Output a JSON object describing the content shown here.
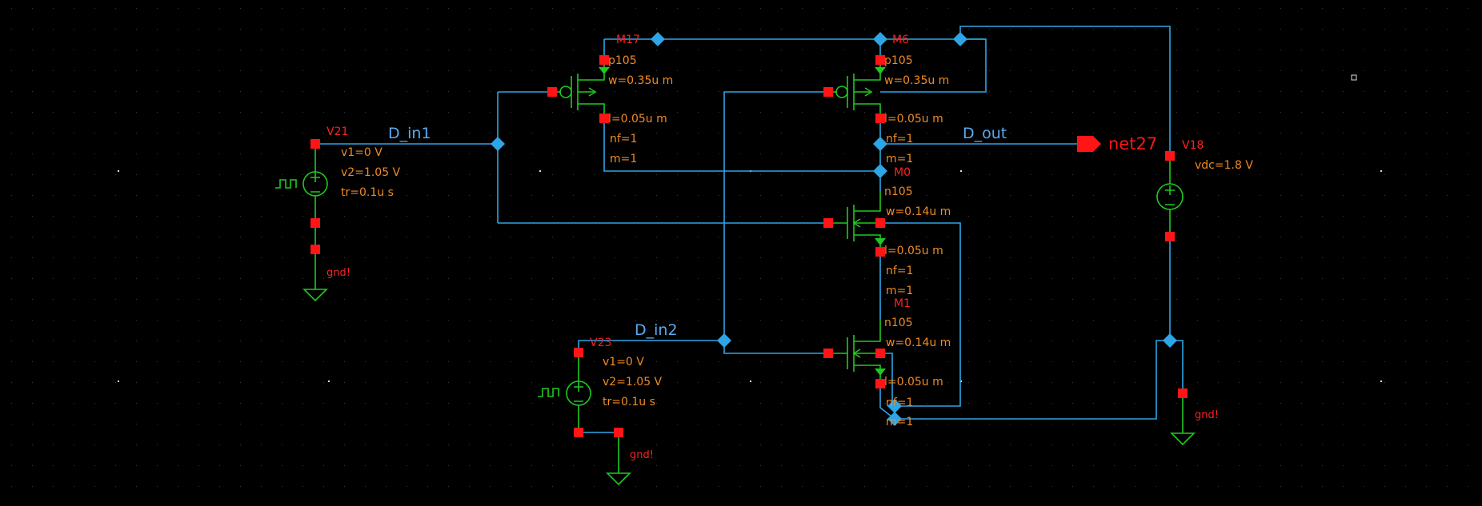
{
  "colors": {
    "background": "#000000",
    "wire": "#2ea5e6",
    "pin": "#ff1515",
    "instance": "#ff2020",
    "param": "#f08a24",
    "symbol": "#20c820",
    "net_label": "#5aaaf0",
    "grid": "#3a3a3a"
  },
  "net_labels": {
    "d_in1": "D_in1",
    "d_in2": "D_in2",
    "d_out": "D_out",
    "output_pin": "net27"
  },
  "transistors": [
    {
      "inst": "M17",
      "model": "p105",
      "w": "w=0.35u m",
      "l": "l=0.05u m",
      "nf": "nf=1",
      "m": "m=1"
    },
    {
      "inst": "M6",
      "model": "p105",
      "w": "w=0.35u m",
      "l": "l=0.05u m",
      "nf": "nf=1",
      "m": "m=1"
    },
    {
      "inst": "M0",
      "model": "n105",
      "w": "w=0.14u m",
      "l": "l=0.05u m",
      "nf": "nf=1",
      "m": "m=1"
    },
    {
      "inst": "M1",
      "model": "n105",
      "w": "w=0.14u m",
      "l": "l=0.05u m",
      "nf": "nf=1",
      "m": "m=1"
    }
  ],
  "sources": [
    {
      "inst": "V21",
      "v1": "v1=0 V",
      "v2": "v2=1.05 V",
      "tr": "tr=0.1u s"
    },
    {
      "inst": "V23",
      "v1": "v1=0 V",
      "v2": "v2=1.05 V",
      "tr": "tr=0.1u s"
    },
    {
      "inst": "V18",
      "vdc": "vdc=1.8 V"
    }
  ],
  "ground_label": "gnd!"
}
